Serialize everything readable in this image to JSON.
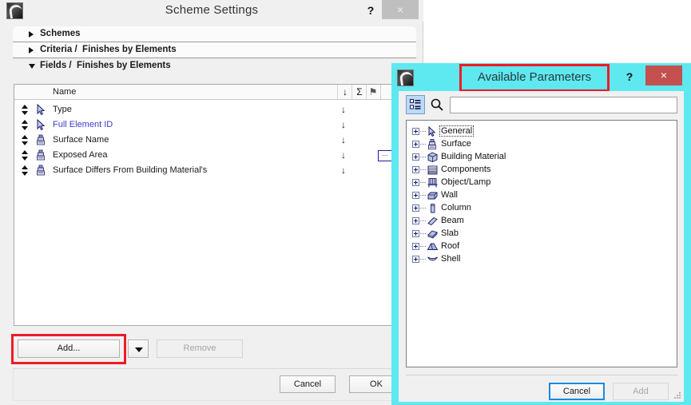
{
  "scheme_window": {
    "title": "Scheme Settings",
    "app_icon": "archicad-icon",
    "help_label": "?",
    "close_label": "×",
    "sections": [
      {
        "label": "Schemes",
        "expanded": false
      },
      {
        "label": "Criteria /  Finishes by Elements",
        "expanded": false
      },
      {
        "label": "Fields /  Finishes by Elements",
        "expanded": true
      }
    ],
    "fields_table": {
      "columns": [
        "",
        "",
        "Name",
        "sort-arrow",
        "sum-sigma",
        "flag"
      ],
      "name_header": "Name",
      "header_icons": [
        "down-arrow-icon",
        "sigma-icon",
        "flag-icon"
      ],
      "rows": [
        {
          "name": "Type",
          "icon": "cursor-icon",
          "link": false,
          "arrow": "↓",
          "options": false
        },
        {
          "name": "Full Element ID",
          "icon": "cursor-icon",
          "link": true,
          "arrow": "↓",
          "options": false
        },
        {
          "name": "Surface Name",
          "icon": "brush-icon",
          "link": false,
          "arrow": "↓",
          "options": false
        },
        {
          "name": "Exposed Area",
          "icon": "brush-icon",
          "link": false,
          "arrow": "↓",
          "options": true,
          "options_label": "…"
        },
        {
          "name": "Surface Differs From Building Material's",
          "icon": "brush-icon",
          "link": false,
          "arrow": "↓",
          "options": false
        }
      ]
    },
    "add_button": "Add...",
    "add_dropdown": "chevron-down-icon",
    "remove_button": "Remove",
    "cancel_button": "Cancel",
    "ok_button": "OK",
    "highlight_color": "#ee1c25"
  },
  "params_window": {
    "title": "Available Parameters",
    "app_icon": "archicad-icon",
    "help_label": "?",
    "close_label": "×",
    "titlebar_color": "#5ee8f0",
    "close_color": "#c4504f",
    "highlight_color": "#ee1c25",
    "toolbar": {
      "tree_toggle": "tree-list-icon",
      "search_icon": "search-icon",
      "search_value": "",
      "search_placeholder": ""
    },
    "tree_items": [
      {
        "label": "General",
        "icon": "cursor-icon",
        "focused": true
      },
      {
        "label": "Surface",
        "icon": "brush-icon",
        "focused": false
      },
      {
        "label": "Building Material",
        "icon": "cube-icon",
        "focused": false
      },
      {
        "label": "Components",
        "icon": "components-icon",
        "focused": false
      },
      {
        "label": "Object/Lamp",
        "icon": "object-lamp-icon",
        "focused": false
      },
      {
        "label": "Wall",
        "icon": "wall-icon",
        "focused": false
      },
      {
        "label": "Column",
        "icon": "column-icon",
        "focused": false
      },
      {
        "label": "Beam",
        "icon": "beam-icon",
        "focused": false
      },
      {
        "label": "Slab",
        "icon": "slab-icon",
        "focused": false
      },
      {
        "label": "Roof",
        "icon": "roof-icon",
        "focused": false
      },
      {
        "label": "Shell",
        "icon": "shell-icon",
        "focused": false
      }
    ],
    "cancel_button": "Cancel",
    "add_button": "Add"
  }
}
